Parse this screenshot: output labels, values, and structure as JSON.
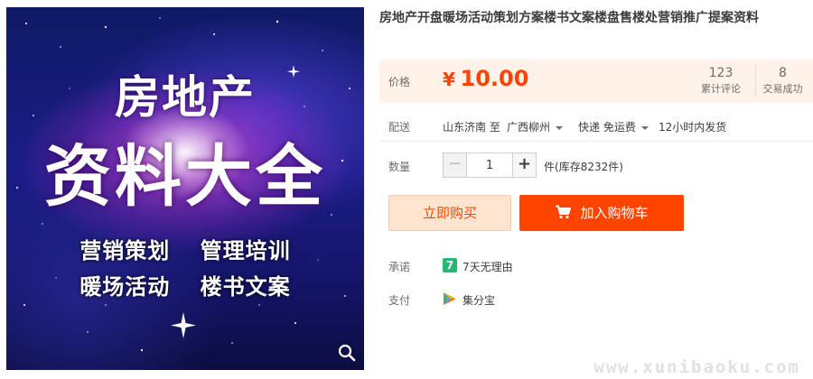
{
  "image": {
    "title_line1": "房地产",
    "title_line2": "资料大全",
    "tags": [
      "营销策划",
      "管理培训",
      "暖场活动",
      "楼书文案"
    ],
    "zoom_icon": "magnifier-icon"
  },
  "product": {
    "title": "房地产开盘暖场活动策划方案楼书文案楼盘售楼处营销推广提案资料"
  },
  "price": {
    "label": "价格",
    "currency": "¥",
    "value": "10.00",
    "reviews_count": "123",
    "reviews_label": "累计评论",
    "trades_count": "8",
    "trades_label": "交易成功",
    "color": "#ff4400"
  },
  "shipping": {
    "label": "配送",
    "from": "山东济南 至",
    "to": "广西柳州",
    "method": "快递 免运费",
    "dispatch": "12小时内发货"
  },
  "quantity": {
    "label": "数量",
    "value": "1",
    "minus": "−",
    "plus": "+",
    "stock": "件(库存8232件)"
  },
  "actions": {
    "buy_now": "立即购买",
    "add_to_cart": "加入购物车",
    "cart_icon": "cart-icon"
  },
  "promise": {
    "label": "承诺",
    "icon_text": "7",
    "text": "7天无理由"
  },
  "payment": {
    "label": "支付",
    "text": "集分宝"
  },
  "watermark": "www.xunibaoku.com"
}
